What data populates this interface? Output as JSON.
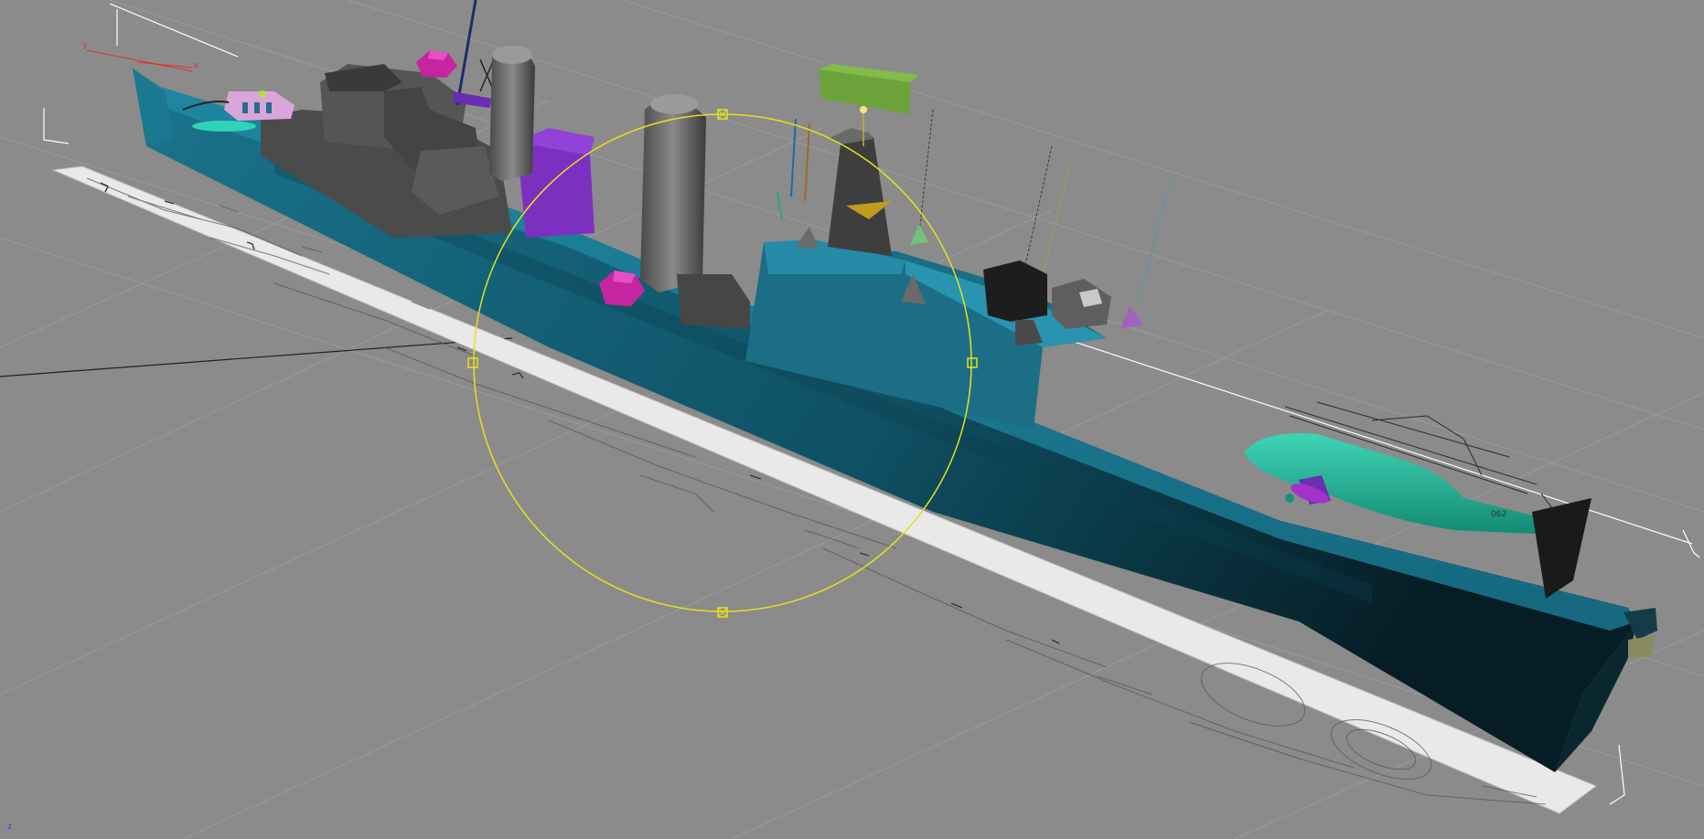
{
  "viewport": {
    "mode": "perspective",
    "background": "#8b8b8b",
    "grid_color": "#9a9a9a",
    "gizmo_color": "#e6e21a"
  },
  "pivot_axes": {
    "x_label": "x",
    "y_label": "y",
    "x_color": "#e03030",
    "y_color": "#e03030"
  },
  "corner_axis": {
    "z_label": "z",
    "color": "#2a3cff"
  },
  "scene_objects": [
    {
      "name": "ship-hull",
      "color": "#1d6f87"
    },
    {
      "name": "superstructure",
      "color": "#505050"
    },
    {
      "name": "helicopter",
      "color": "#1fa98e"
    },
    {
      "name": "blueprint-plane",
      "color": "#e8e8e8"
    },
    {
      "name": "radar-box",
      "color": "#6b9a34"
    }
  ]
}
